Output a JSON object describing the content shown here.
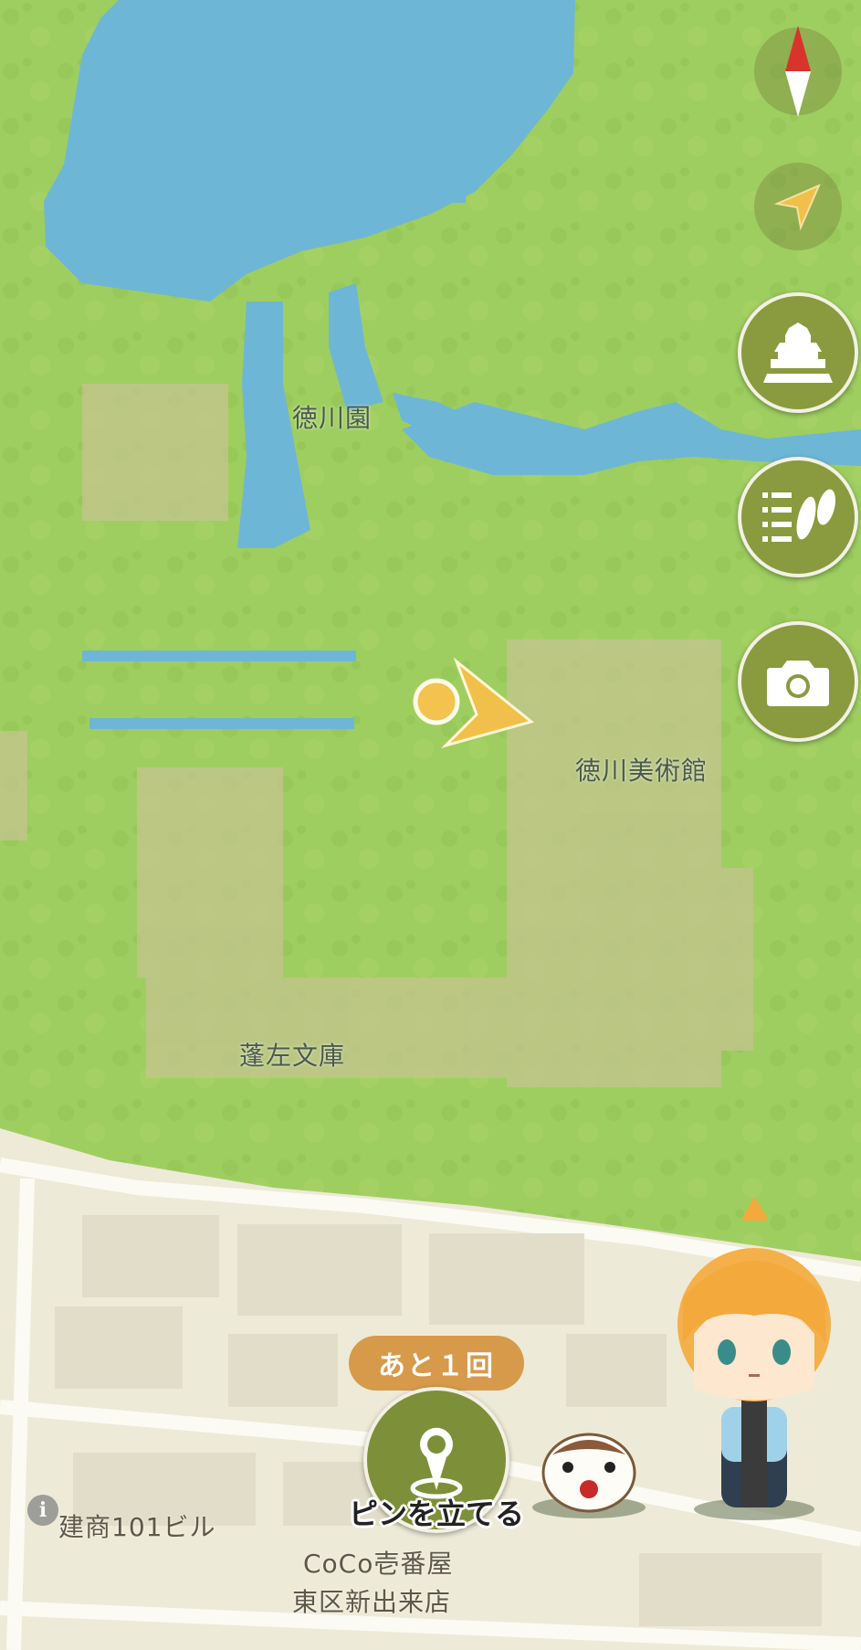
{
  "map": {
    "labels": {
      "tokugawaen": "徳川園",
      "museum": "徳川美術館",
      "hosa_bunko": "蓬左文庫",
      "building": "建商101ビル",
      "coco_line1": "CoCo壱番屋",
      "coco_line2": "東区新出来店"
    }
  },
  "controls": {
    "compass": "compass-icon",
    "locate": "location-arrow-icon",
    "castle": "castle-icon",
    "footprints": "footprints-list-icon",
    "camera": "camera-icon"
  },
  "pin": {
    "remaining": "あと１回",
    "label": "ピンを立てる"
  },
  "info": "i",
  "colors": {
    "grass": "#9ccb5c",
    "water": "#6eb6d6",
    "button": "#8a9a3f",
    "badge": "#d69a4a"
  }
}
